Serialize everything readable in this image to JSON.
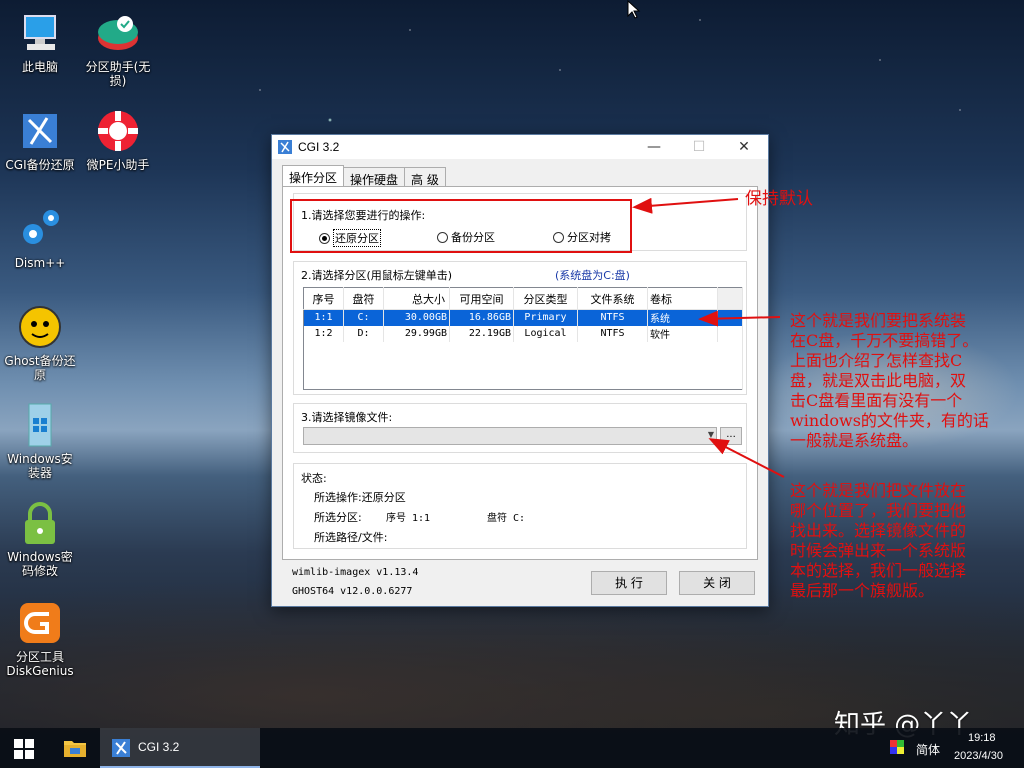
{
  "desktop": {
    "icons": [
      {
        "label": "此电脑",
        "icon": "computer-icon"
      },
      {
        "label": "分区助手(无损)",
        "icon": "partition-assistant-icon"
      },
      {
        "label": "CGI备份还原",
        "icon": "cgi-icon"
      },
      {
        "label": "微PE小助手",
        "icon": "lifebuoy-icon"
      },
      {
        "label": "Dism++",
        "icon": "gears-icon"
      },
      {
        "label": "Ghost备份还原",
        "icon": "ghost-icon"
      },
      {
        "label": "Windows安装器",
        "icon": "windows-installer-icon"
      },
      {
        "label": "Windows密码修改",
        "icon": "lock-icon"
      },
      {
        "label": "分区工具DiskGenius",
        "icon": "diskgenius-icon"
      }
    ]
  },
  "window": {
    "title": "CGI 3.2",
    "minimize": "—",
    "maximize": "☐",
    "close": "✕",
    "tabs": [
      "操作分区",
      "操作硬盘",
      "高 级"
    ],
    "section1": {
      "label": "1.请选择您要进行的操作:",
      "options": [
        "还原分区",
        "备份分区",
        "分区对拷"
      ],
      "selected": "还原分区"
    },
    "section2": {
      "label": "2.请选择分区(用鼠标左键单击)",
      "hint": "(系统盘为C:盘)",
      "columns": [
        "序号",
        "盘符",
        "总大小",
        "可用空间",
        "分区类型",
        "文件系统",
        "卷标"
      ],
      "rows": [
        [
          "1:1",
          "C:",
          "30.00GB",
          "16.86GB",
          "Primary",
          "NTFS",
          "系统"
        ],
        [
          "1:2",
          "D:",
          "29.99GB",
          "22.19GB",
          "Logical",
          "NTFS",
          "软件"
        ]
      ]
    },
    "section3": {
      "label": "3.请选择镜像文件:",
      "browse": "..."
    },
    "status": {
      "label": "状态:",
      "operation": "所选操作:还原分区",
      "partition_label": "所选分区:",
      "partition_index": "序号 1:1",
      "partition_drive": "盘符 C:",
      "path": "所选路径/文件:"
    },
    "footer": {
      "wimlib": "wimlib-imagex v1.13.4",
      "ghost": "GHOST64 v12.0.0.6277",
      "execute": "执 行",
      "close": "关 闭"
    }
  },
  "annotations": {
    "keep_default": "保持默认",
    "system_disk": [
      "这个就是我们要把系统装",
      "在C盘，千万不要搞错了。",
      "上面也介绍了怎样查找C",
      "盘，就是双击此电脑，双",
      "击C盘看里面有没有一个",
      "windows的文件夹，有的话",
      "一般就是系统盘。"
    ],
    "image_file": [
      "这个就是我们把文件放在",
      "哪个位置了，我们要把他",
      "找出来。选择镜像文件的",
      "时候会弹出来一个系统版",
      "本的选择，我们一般选择",
      "最后那一个旗舰版。"
    ],
    "color": "#e01010"
  },
  "watermark": "知乎 @丫丫",
  "taskbar": {
    "app_label": "CGI 3.2",
    "ime": "简体",
    "time": "19:18",
    "date": "2023/4/30"
  }
}
